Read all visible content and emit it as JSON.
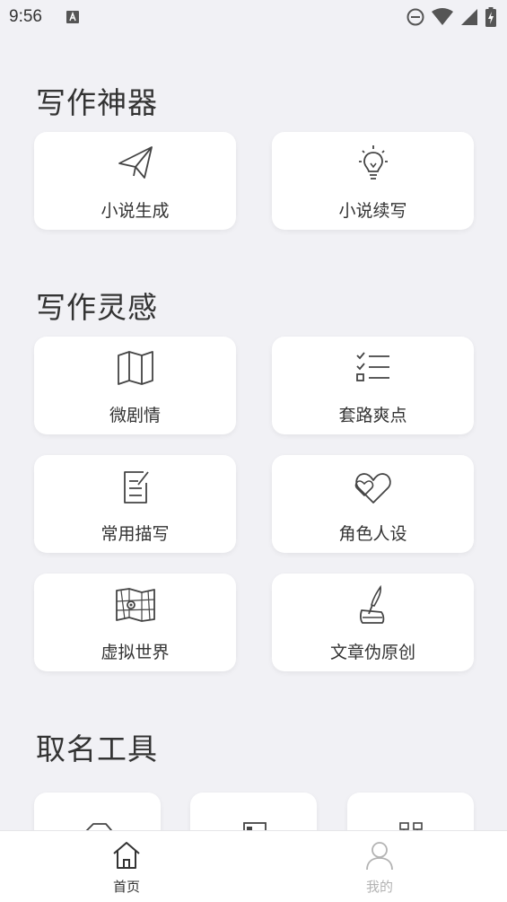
{
  "status_bar": {
    "time": "9:56",
    "icons": [
      "a-notification-icon",
      "do-not-disturb-icon",
      "wifi-icon",
      "signal-icon",
      "battery-charging-icon"
    ]
  },
  "sections": {
    "writing_tools": {
      "title": "写作神器",
      "items": [
        {
          "label": "小说生成",
          "icon": "paper-plane-icon"
        },
        {
          "label": "小说续写",
          "icon": "light-bulb-icon"
        }
      ]
    },
    "inspiration": {
      "title": "写作灵感",
      "items": [
        {
          "label": "微剧情",
          "icon": "map-icon"
        },
        {
          "label": "套路爽点",
          "icon": "checklist-icon"
        },
        {
          "label": "常用描写",
          "icon": "edit-note-icon"
        },
        {
          "label": "角色人设",
          "icon": "hearts-icon"
        },
        {
          "label": "虚拟世界",
          "icon": "world-map-icon"
        },
        {
          "label": "文章伪原创",
          "icon": "quill-ink-icon"
        }
      ]
    },
    "naming": {
      "title": "取名工具",
      "items": [
        {
          "icon": "house-icon"
        },
        {
          "icon": "board-icon"
        },
        {
          "icon": "people-icon"
        }
      ]
    }
  },
  "bottom_nav": {
    "items": [
      {
        "label": "首页",
        "icon": "home-icon",
        "active": true
      },
      {
        "label": "我的",
        "icon": "user-icon",
        "active": false
      }
    ]
  },
  "colors": {
    "background": "#f1f1f5",
    "card": "#ffffff",
    "text": "#333333",
    "inactive": "#b3b3b3"
  }
}
